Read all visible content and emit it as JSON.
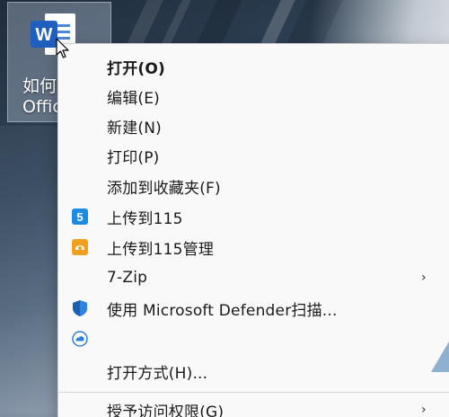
{
  "desktop": {
    "icon": {
      "name": "word-document",
      "label_line1": "如何",
      "label_line2": "Office"
    }
  },
  "context_menu": {
    "items": [
      {
        "label": "打开(O)",
        "bold": true,
        "icon": null,
        "submenu": false
      },
      {
        "label": "编辑(E)",
        "bold": false,
        "icon": null,
        "submenu": false
      },
      {
        "label": "新建(N)",
        "bold": false,
        "icon": null,
        "submenu": false
      },
      {
        "label": "打印(P)",
        "bold": false,
        "icon": null,
        "submenu": false
      },
      {
        "label": "添加到收藏夹(F)",
        "bold": false,
        "icon": null,
        "submenu": false
      },
      {
        "label": "上传到115",
        "bold": false,
        "icon": "115-upload-icon",
        "submenu": false
      },
      {
        "label": "上传到115管理",
        "bold": false,
        "icon": "115-manager-icon",
        "submenu": false
      },
      {
        "label": "7-Zip",
        "bold": false,
        "icon": null,
        "submenu": true
      },
      {
        "label": "使用 Microsoft Defender扫描...",
        "bold": false,
        "icon": "defender-shield-icon",
        "submenu": false
      },
      {
        "label": "",
        "bold": false,
        "icon": "cloud-sync-icon",
        "submenu": false
      },
      {
        "label": "打开方式(H)...",
        "bold": false,
        "icon": null,
        "submenu": false
      },
      {
        "label": "授予访问权限(G)",
        "bold": false,
        "icon": null,
        "submenu": true
      }
    ],
    "submenu_arrow": "›"
  },
  "colors": {
    "menu_bg": "#f9f9f9",
    "accent_blue": "#1e6fd9",
    "accent_orange": "#f0a020",
    "word_blue": "#1f5fbf"
  }
}
